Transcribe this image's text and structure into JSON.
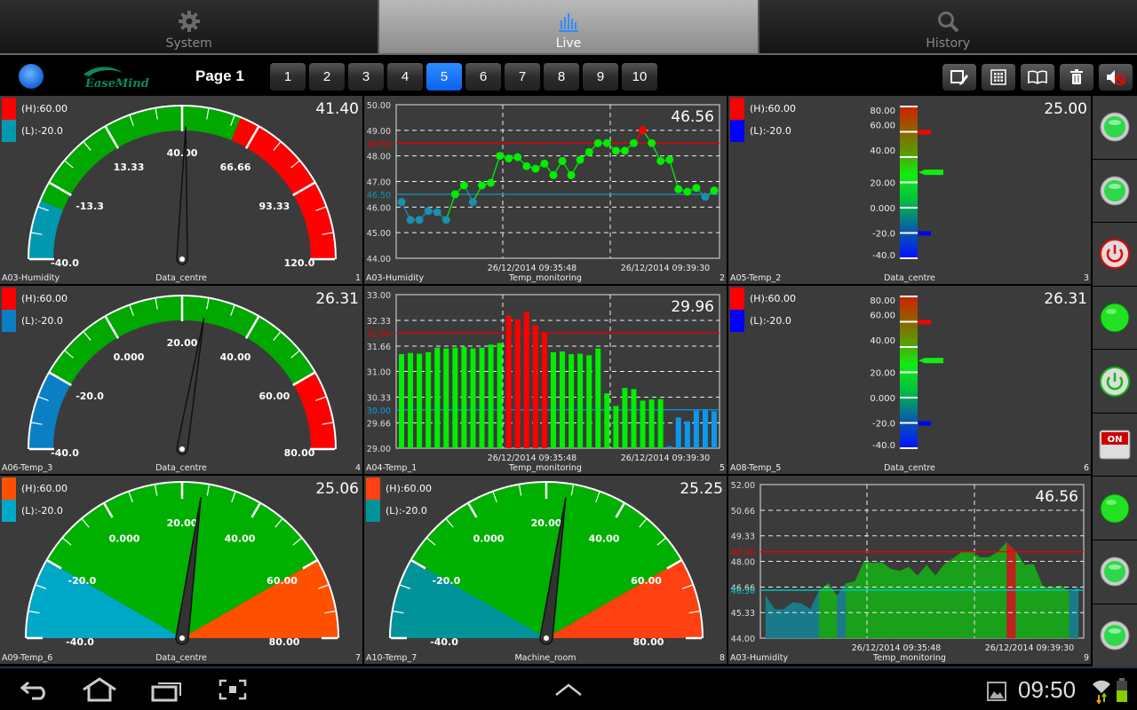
{
  "tabs": [
    {
      "label": "System",
      "icon": "gear-icon"
    },
    {
      "label": "Live",
      "icon": "live-chart-icon",
      "active": true
    },
    {
      "label": "History",
      "icon": "search-icon"
    }
  ],
  "toolbar": {
    "logo": "EaseMind",
    "page_label": "Page 1",
    "pages": [
      "1",
      "2",
      "3",
      "4",
      "5",
      "6",
      "7",
      "8",
      "9",
      "10"
    ],
    "active_page": "5",
    "tools": [
      "edit-icon",
      "grid-icon",
      "book-icon",
      "trash-icon",
      "mute-icon"
    ]
  },
  "colors": {
    "high": "#ff0000",
    "low_teal": "#0099b0",
    "low_blue": "#0a7fc4",
    "green": "#00b000",
    "bright_green": "#00ee00",
    "orange": "#ff5000",
    "accent": "#0a62f0"
  },
  "panels": [
    {
      "type": "arc",
      "name": "A03-Humidity",
      "location": "Data_centre",
      "index": "1",
      "value": "41.40",
      "num": 41.4,
      "min": -40,
      "max": 120,
      "high": 60,
      "low": -20,
      "high_label": "(H):60.00",
      "low_label": "(L):-20.0",
      "low_color": "#0099b0",
      "high_color": "#ff0000",
      "labels": [
        "-40.0",
        "-13.3",
        "13.33",
        "40.00",
        "66.66",
        "93.33",
        "120.0"
      ]
    },
    {
      "type": "line",
      "name": "A03-Humidity",
      "location": "Temp_monitoring",
      "index": "2",
      "value": "46.56",
      "ymin": 44,
      "ymax": 50,
      "ticks": [
        "44.00",
        "45.00",
        "46.00",
        "47.00",
        "48.00",
        "49.00",
        "50.00"
      ],
      "tick_values": [
        44,
        45,
        46,
        47,
        48,
        49,
        50
      ],
      "high": 48.5,
      "low": 46.5,
      "high_label": "48.50",
      "low_label": "46.50",
      "low_color": "#1a8fb0",
      "dates": [
        "26/12/2014 09:35:48",
        "26/12/2014 09:39:30"
      ],
      "series": [
        46.2,
        45.5,
        45.5,
        45.85,
        45.8,
        45.5,
        46.5,
        46.85,
        46.2,
        46.85,
        46.95,
        48.0,
        47.9,
        47.95,
        47.6,
        47.5,
        47.7,
        47.25,
        47.8,
        47.25,
        47.85,
        48.15,
        48.5,
        48.5,
        48.2,
        48.2,
        48.5,
        49.0,
        48.5,
        47.8,
        47.85,
        46.7,
        46.6,
        46.75,
        46.4,
        46.65
      ]
    },
    {
      "type": "vbar",
      "name": "A05-Temp_2",
      "location": "Data_centre",
      "index": "3",
      "value": "25.00",
      "num": 25,
      "min": -40,
      "max": 80,
      "high": 60,
      "low": -20,
      "high_label": "(H):60.00",
      "low_label": "(L):-20.0",
      "low_color": "#0000ff",
      "high_color": "#ff0000",
      "labels": [
        "-40.0",
        "-20.0",
        "0.000",
        "20.00",
        "40.00",
        "60.00",
        "80.00"
      ]
    },
    {
      "type": "arc",
      "name": "A06-Temp_3",
      "location": "Data_centre",
      "index": "4",
      "value": "26.31",
      "num": 26.31,
      "min": -40,
      "max": 80,
      "high": 60,
      "low": -20,
      "high_label": "(H):60.00",
      "low_label": "(L):-20.0",
      "low_color": "#0a7fc4",
      "high_color": "#ff0000",
      "labels": [
        "-40.0",
        "-20.0",
        "0.000",
        "20.00",
        "40.00",
        "60.00",
        "80.00"
      ]
    },
    {
      "type": "bar",
      "name": "A04-Temp_1",
      "location": "Temp_monitoring",
      "index": "5",
      "value": "29.96",
      "ymin": 29,
      "ymax": 33,
      "ticks": [
        "29.00",
        "29.66",
        "30.33",
        "31.00",
        "31.66",
        "32.33",
        "33.00"
      ],
      "tick_values": [
        29,
        29.66,
        30.33,
        31,
        31.66,
        32.33,
        33
      ],
      "high": 32,
      "low": 30,
      "high_label": "32.00",
      "low_label": "30.00",
      "low_color": "#0a99ee",
      "dates": [
        "26/12/2014 09:35:48",
        "26/12/2014 09:39:30"
      ],
      "series": [
        31.45,
        31.48,
        31.46,
        31.5,
        31.62,
        31.6,
        31.62,
        31.64,
        31.6,
        31.62,
        31.7,
        31.74,
        32.45,
        32.36,
        32.55,
        32.2,
        32.02,
        31.5,
        31.52,
        31.45,
        31.46,
        31.42,
        31.6,
        30.43,
        30.1,
        30.57,
        30.54,
        30.24,
        30.27,
        30.28,
        29.05,
        29.8,
        29.7,
        29.98,
        29.99,
        29.96
      ]
    },
    {
      "type": "vbar",
      "name": "A08-Temp_5",
      "location": "Data_centre",
      "index": "6",
      "value": "26.31",
      "num": 26.31,
      "min": -40,
      "max": 80,
      "high": 60,
      "low": -20,
      "high_label": "(H):60.00",
      "low_label": "(L):-20.0",
      "low_color": "#0000ff",
      "high_color": "#ff0000",
      "labels": [
        "-40.0",
        "-20.0",
        "0.000",
        "20.00",
        "40.00",
        "60.00",
        "80.00"
      ]
    },
    {
      "type": "pie",
      "name": "A09-Temp_6",
      "location": "Data_centre",
      "index": "7",
      "value": "25.06",
      "num": 25.06,
      "min": -40,
      "max": 80,
      "high": 60,
      "low": -20,
      "high_label": "(H):60.00",
      "low_label": "(L):-20.0",
      "low_color": "#00a8c8",
      "high_color": "#ff5000",
      "labels": [
        "-40.0",
        "-20.0",
        "0.000",
        "20.00",
        "40.00",
        "60.00",
        "80.00"
      ]
    },
    {
      "type": "pie",
      "name": "A10-Temp_7",
      "location": "Machine_room",
      "index": "8",
      "value": "25.25",
      "num": 25.25,
      "min": -40,
      "max": 80,
      "high": 60,
      "low": -20,
      "high_label": "(H):60.00",
      "low_label": "(L):-20.0",
      "low_color": "#00939a",
      "high_color": "#ff4010",
      "labels": [
        "-40.0",
        "-20.0",
        "0.000",
        "20.00",
        "40.00",
        "60.00",
        "80.00"
      ]
    },
    {
      "type": "area",
      "name": "A03-Humidity",
      "location": "Temp_monitoring",
      "index": "9",
      "value": "46.56",
      "ymin": 44,
      "ymax": 52,
      "ticks": [
        "44.00",
        "45.33",
        "46.66",
        "48.00",
        "49.33",
        "50.66",
        "52.00"
      ],
      "tick_values": [
        44,
        45.33,
        46.66,
        48,
        49.33,
        50.66,
        52
      ],
      "high": 48.5,
      "low": 46.5,
      "high_label": "48.50",
      "low_label": "46.50",
      "low_color": "#00c8c8",
      "dates": [
        "26/12/2014 09:35:48",
        "26/12/2014 09:39:30"
      ],
      "series": [
        46.2,
        45.5,
        45.5,
        45.85,
        45.8,
        45.5,
        46.5,
        46.85,
        46.2,
        46.85,
        46.95,
        48.0,
        47.9,
        47.95,
        47.6,
        47.5,
        47.7,
        47.25,
        47.8,
        47.25,
        47.85,
        48.15,
        48.5,
        48.5,
        48.2,
        48.2,
        48.5,
        49.0,
        48.5,
        47.8,
        47.85,
        46.7,
        46.6,
        46.75,
        46.4,
        46.65
      ]
    }
  ],
  "side_buttons": [
    {
      "kind": "led-green",
      "name": "indicator-led-1"
    },
    {
      "kind": "led-green",
      "name": "indicator-led-2"
    },
    {
      "kind": "power-red",
      "name": "power-button-off"
    },
    {
      "kind": "ball-green",
      "name": "status-light-1"
    },
    {
      "kind": "power-green",
      "name": "power-button-on"
    },
    {
      "kind": "switch-on",
      "name": "on-switch",
      "label": "ON"
    },
    {
      "kind": "ball-green",
      "name": "status-light-2"
    },
    {
      "kind": "led-green",
      "name": "indicator-led-3"
    },
    {
      "kind": "led-green",
      "name": "indicator-led-4"
    }
  ],
  "statusbar": {
    "time": "09:50"
  }
}
